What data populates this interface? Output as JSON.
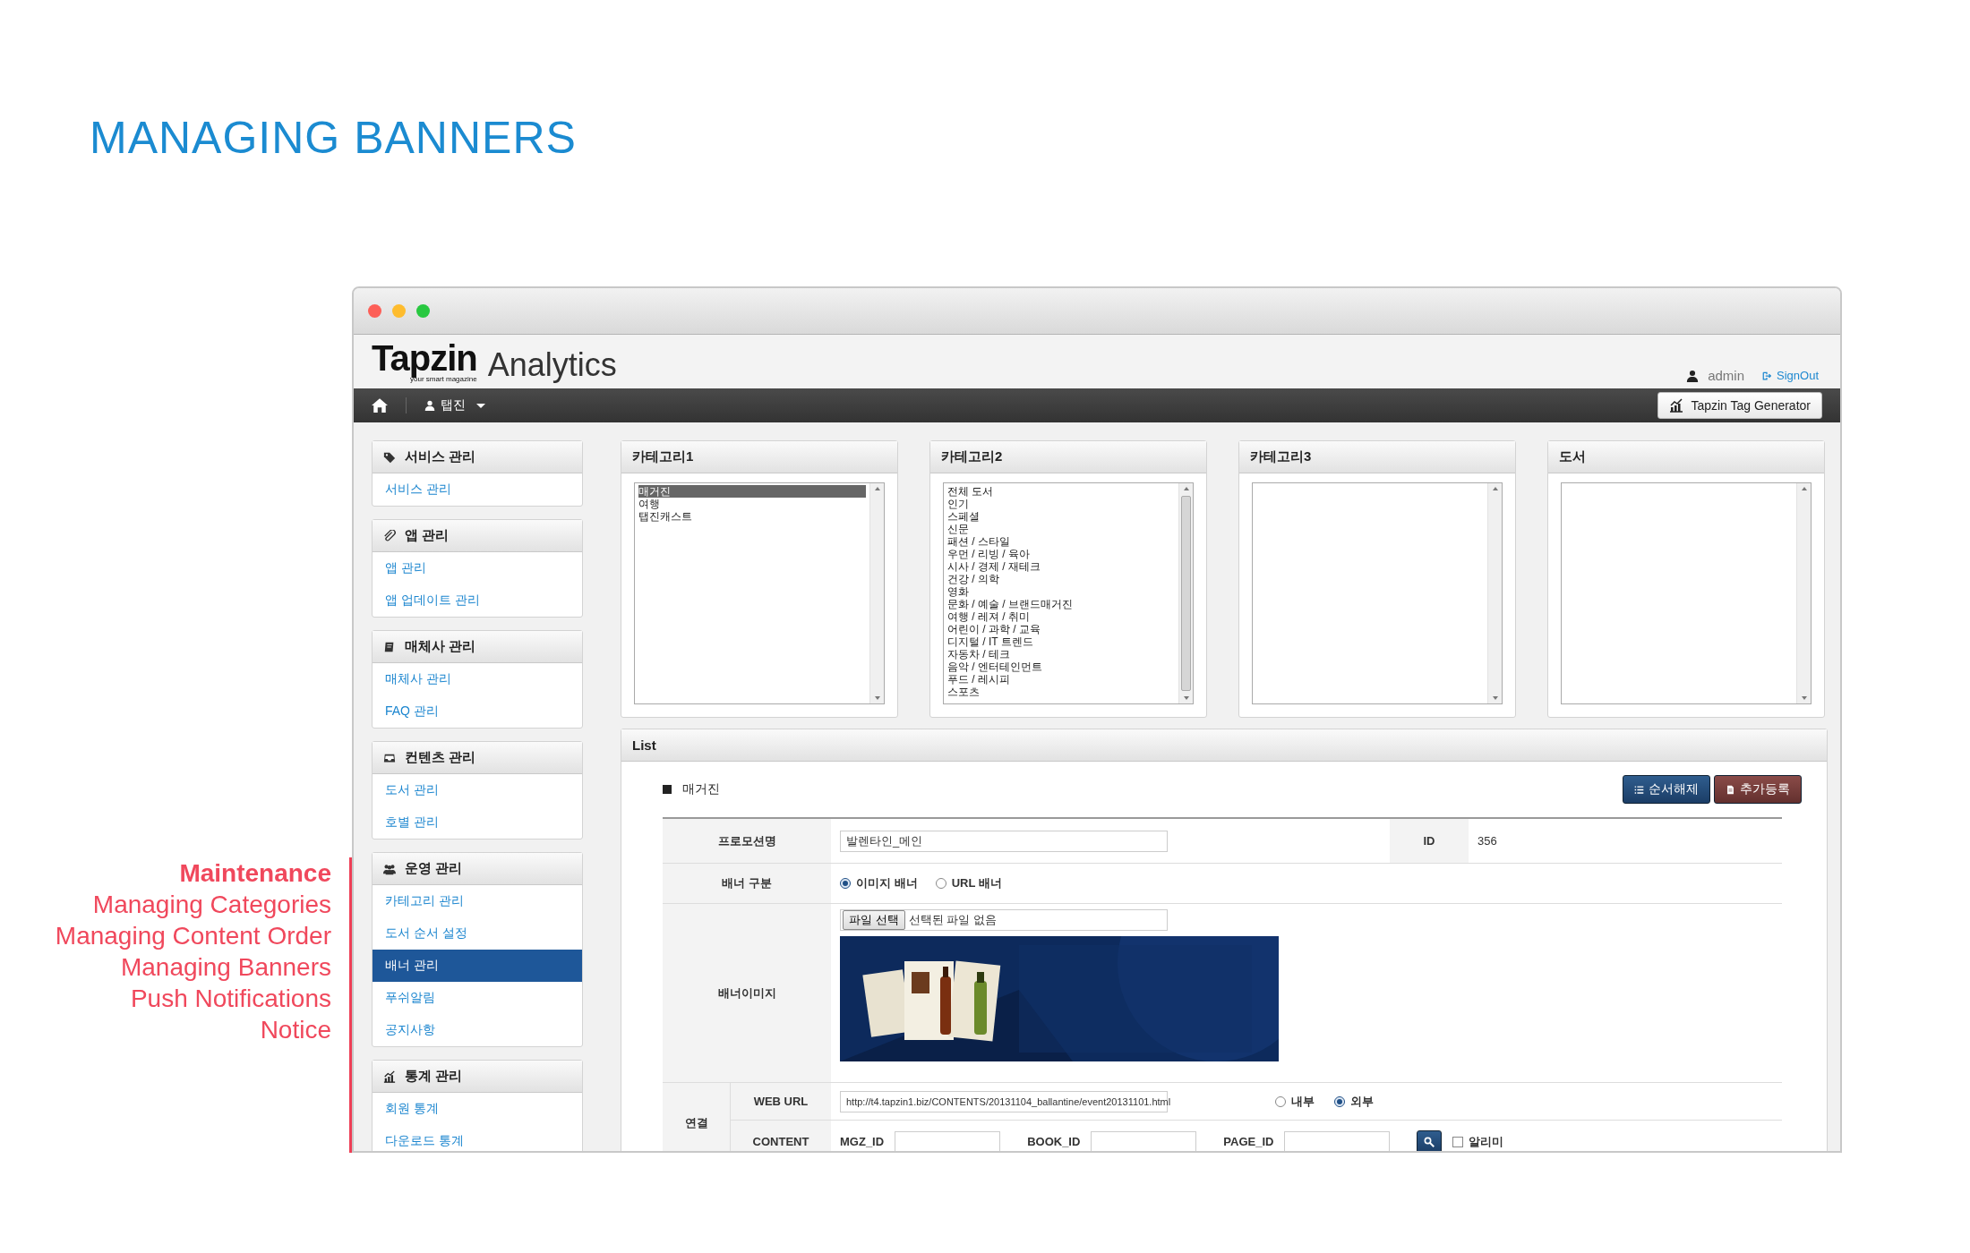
{
  "slide_title": "MANAGING BANNERS",
  "legend": {
    "heading": "Maintenance",
    "items": [
      "Managing Categories",
      "Managing Content Order",
      "Managing Banners",
      "Push Notifications",
      "Notice"
    ]
  },
  "window": {
    "logo": "Tapzin",
    "logo_tagline": "your smart magazine",
    "product": "Analytics",
    "user": "admin",
    "signout": "SignOut",
    "nav_menu": "탭진",
    "tool_button": "Tapzin Tag Generator"
  },
  "sidebar": [
    {
      "title": "서비스 관리",
      "items": [
        {
          "label": "서비스 관리",
          "selected": false
        }
      ]
    },
    {
      "title": "앱 관리",
      "items": [
        {
          "label": "앱 관리",
          "selected": false
        },
        {
          "label": "앱 업데이트 관리",
          "selected": false
        }
      ]
    },
    {
      "title": "매체사 관리",
      "items": [
        {
          "label": "매체사 관리",
          "selected": false
        },
        {
          "label": "FAQ 관리",
          "selected": false
        }
      ]
    },
    {
      "title": "컨텐츠 관리",
      "items": [
        {
          "label": "도서 관리",
          "selected": false
        },
        {
          "label": "호별 관리",
          "selected": false
        }
      ]
    },
    {
      "title": "운영 관리",
      "items": [
        {
          "label": "카테고리 관리",
          "selected": false
        },
        {
          "label": "도서 순서 설정",
          "selected": false
        },
        {
          "label": "배너 관리",
          "selected": true
        },
        {
          "label": "푸쉬알림",
          "selected": false
        },
        {
          "label": "공지사항",
          "selected": false
        }
      ]
    },
    {
      "title": "통계 관리",
      "items": [
        {
          "label": "회원 통계",
          "selected": false
        },
        {
          "label": "다운로드 통계",
          "selected": false
        }
      ]
    }
  ],
  "categories": [
    {
      "title": "카테고리1",
      "items": [
        {
          "label": "매거진",
          "selected": true
        },
        {
          "label": "여행",
          "selected": false
        },
        {
          "label": "탭진캐스트",
          "selected": false
        }
      ]
    },
    {
      "title": "카테고리2",
      "items": [
        {
          "label": "전체 도서",
          "selected": false
        },
        {
          "label": "인기",
          "selected": false
        },
        {
          "label": "스페셜",
          "selected": false
        },
        {
          "label": "신문",
          "selected": false
        },
        {
          "label": "패션 / 스타일",
          "selected": false
        },
        {
          "label": "우먼 / 리빙 / 육아",
          "selected": false
        },
        {
          "label": "시사 / 경제 / 재테크",
          "selected": false
        },
        {
          "label": "건강 / 의학",
          "selected": false
        },
        {
          "label": "영화",
          "selected": false
        },
        {
          "label": "문화 / 예술 / 브랜드매거진",
          "selected": false
        },
        {
          "label": "여행 / 레져 / 취미",
          "selected": false
        },
        {
          "label": "어린이 / 과학 / 교육",
          "selected": false
        },
        {
          "label": "디지털 / IT 트렌드",
          "selected": false
        },
        {
          "label": "자동차 / 테크",
          "selected": false
        },
        {
          "label": "음악 / 엔터테인먼트",
          "selected": false
        },
        {
          "label": "푸드 / 레시피",
          "selected": false
        },
        {
          "label": "스포츠",
          "selected": false
        }
      ]
    },
    {
      "title": "카테고리3"
    },
    {
      "title": "도서"
    }
  ],
  "list": {
    "title": "List",
    "section": "매거진",
    "buttons": [
      {
        "label": "순서해제",
        "kind": "primary"
      },
      {
        "label": "추가등록",
        "kind": "danger"
      }
    ],
    "form": {
      "promo_label": "프로모션명",
      "promo_value": "발렌타인_메인",
      "id_label": "ID",
      "id_value": "356",
      "banner_type_label": "배너 구분",
      "banner_types": [
        {
          "label": "이미지 배너",
          "selected": true
        },
        {
          "label": "URL 배너",
          "selected": false
        }
      ],
      "image_label": "배너이미지",
      "file_button": "파일 선택",
      "file_status": "선택된 파일 없음",
      "link_label": "연결",
      "web_url_label": "WEB URL",
      "web_url": "http://t4.tapzin1.biz/CONTENTS/20131104_ballantine/event20131101.html",
      "link_targets": [
        {
          "label": "내부",
          "selected": false
        },
        {
          "label": "외부",
          "selected": true
        }
      ],
      "content_label": "CONTENT",
      "content_fields": [
        {
          "label": "MGZ_ID"
        },
        {
          "label": "BOOK_ID"
        },
        {
          "label": "PAGE_ID"
        }
      ],
      "notify": {
        "label": "알리미",
        "checked": false
      }
    }
  }
}
